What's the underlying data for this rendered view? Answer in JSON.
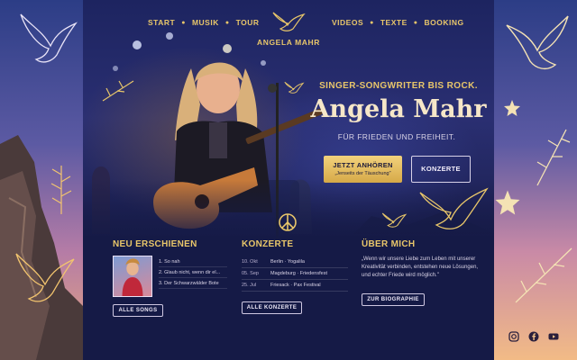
{
  "nav": {
    "left": [
      "START",
      "MUSIK",
      "TOUR"
    ],
    "right": [
      "VIDEOS",
      "TEXTE",
      "BOOKING"
    ],
    "brand": "ANGELA MAHR"
  },
  "hero": {
    "tagline": "SINGER-SONGWRITER BIS ROCK.",
    "name": "Angela Mahr",
    "subtitle": "FÜR FRIEDEN UND FREIHEIT.",
    "cta_primary": "JETZT ANHÖREN",
    "cta_primary_sub": "„Jenseits der Täuschung\"",
    "cta_secondary": "KONZERTE"
  },
  "songs": {
    "title": "NEU ERSCHIENEN",
    "items": [
      "1. So nah",
      "2. Glaub nicht, wenn dir el...",
      "3. Der Schwarzwälder Bote"
    ],
    "button": "ALLE SONGS"
  },
  "concerts": {
    "title": "KONZERTE",
    "rows": [
      {
        "date": "10. Okt",
        "place": "Berlin · Yogalila"
      },
      {
        "date": "05. Sep",
        "place": "Magdeburg · Friedensfest"
      },
      {
        "date": "25. Jul",
        "place": "Friesack · Pax Festival"
      }
    ],
    "button": "ALLE KONZERTE"
  },
  "about": {
    "title": "ÜBER MICH",
    "quote": "„Wenn wir unsere Liebe zum Leben mit unserer Kreativität verbinden, entstehen neue Lösungen, und echter Friede wird möglich.\"",
    "button": "ZUR BIOGRAPHIE"
  },
  "socials": [
    "instagram-icon",
    "facebook-icon",
    "youtube-icon"
  ],
  "colors": {
    "gold": "#e8c66a",
    "panel": "#151a46",
    "cream": "#f6e7c8"
  }
}
